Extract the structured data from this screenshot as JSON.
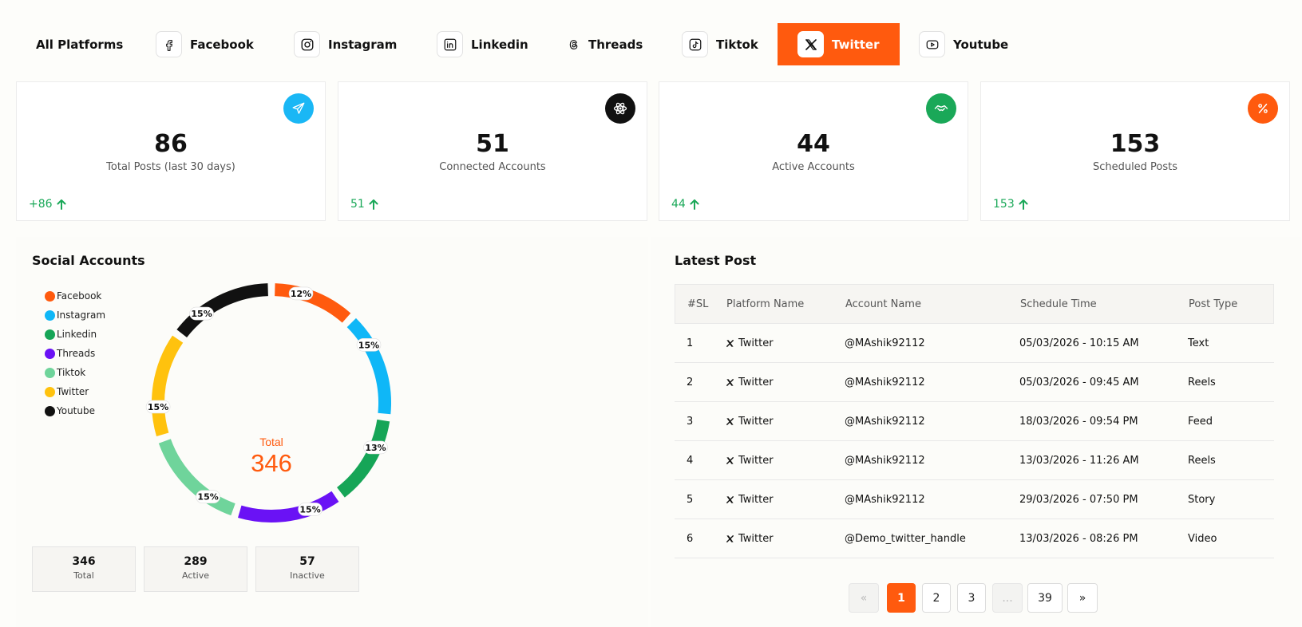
{
  "tabs": [
    {
      "label": "All Platforms",
      "icon": "none"
    },
    {
      "label": "Facebook",
      "icon": "facebook-icon"
    },
    {
      "label": "Instagram",
      "icon": "instagram-icon"
    },
    {
      "label": "Linkedin",
      "icon": "linkedin-icon"
    },
    {
      "label": "Threads",
      "icon": "threads-icon"
    },
    {
      "label": "Tiktok",
      "icon": "tiktok-icon"
    },
    {
      "label": "Twitter",
      "icon": "x-icon",
      "active": true
    },
    {
      "label": "Youtube",
      "icon": "youtube-icon"
    }
  ],
  "stats": [
    {
      "value": "86",
      "label": "Total Posts (last 30 days)",
      "delta": "+86",
      "color": "#1ab7f5",
      "icon": "send-icon"
    },
    {
      "value": "51",
      "label": "Connected Accounts",
      "delta": "51",
      "color": "#111111",
      "icon": "atom-icon"
    },
    {
      "value": "44",
      "label": "Active Accounts",
      "delta": "44",
      "color": "#1aa858",
      "icon": "handshake-icon"
    },
    {
      "value": "153",
      "label": "Scheduled Posts",
      "delta": "153",
      "color": "#ff5a0e",
      "icon": "percent-icon"
    }
  ],
  "social": {
    "title": "Social Accounts",
    "center_label": "Total",
    "center_value": "346",
    "summary": [
      {
        "value": "346",
        "label": "Total"
      },
      {
        "value": "289",
        "label": "Active"
      },
      {
        "value": "57",
        "label": "Inactive"
      }
    ]
  },
  "chart_data": {
    "type": "pie",
    "categories": [
      "Facebook",
      "Instagram",
      "Linkedin",
      "Threads",
      "Tiktok",
      "Twitter",
      "Youtube"
    ],
    "values": [
      12,
      15,
      13,
      15,
      15,
      15,
      15
    ],
    "labels": [
      "12%",
      "15%",
      "13%",
      "15%",
      "15%",
      "15%",
      "15%"
    ],
    "colors": [
      "#ff5a0e",
      "#0fb7f7",
      "#16a557",
      "#6a12f5",
      "#6fd49b",
      "#ffc20e",
      "#111111"
    ],
    "legend": "left"
  },
  "latest": {
    "title": "Latest Post",
    "columns": [
      "#SL",
      "Platform Name",
      "Account Name",
      "Schedule Time",
      "Post Type"
    ],
    "rows": [
      [
        "1",
        "Twitter",
        "@MAshik92112",
        "05/03/2026 - 10:15 AM",
        "Text"
      ],
      [
        "2",
        "Twitter",
        "@MAshik92112",
        "05/03/2026 - 09:45 AM",
        "Reels"
      ],
      [
        "3",
        "Twitter",
        "@MAshik92112",
        "18/03/2026 - 09:54 PM",
        "Feed"
      ],
      [
        "4",
        "Twitter",
        "@MAshik92112",
        "13/03/2026 - 11:26 AM",
        "Reels"
      ],
      [
        "5",
        "Twitter",
        "@MAshik92112",
        "29/03/2026 - 07:50 PM",
        "Story"
      ],
      [
        "6",
        "Twitter",
        "@Demo_twitter_handle",
        "13/03/2026 - 08:26 PM",
        "Video"
      ]
    ]
  },
  "pagination": {
    "first": "«",
    "pages": [
      "1",
      "2",
      "3",
      "...",
      "39"
    ],
    "last": "»",
    "current": "1"
  }
}
